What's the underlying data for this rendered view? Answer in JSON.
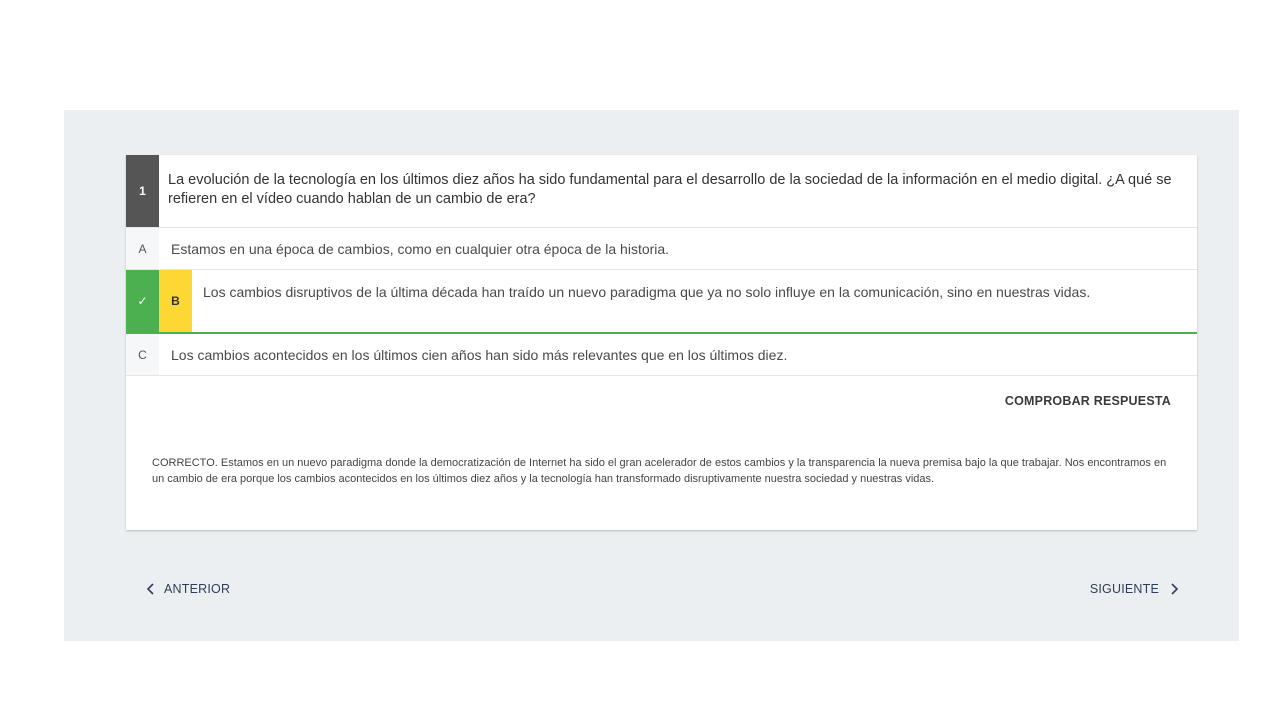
{
  "question": {
    "number": "1",
    "text": "La evolución de la tecnología en los últimos diez años ha sido fundamental para el desarrollo de la sociedad de la información en el medio digital. ¿A qué se refieren en el vídeo cuando hablan de un cambio de era?"
  },
  "options": [
    {
      "letter": "A",
      "text": "Estamos en una época de cambios, como en cualquier otra época de la historia."
    },
    {
      "letter": "B",
      "text": "Los cambios disruptivos de la última década han traído un nuevo paradigma que ya no solo influye en la comunicación, sino en nuestras vidas.",
      "selected": true,
      "correct": true
    },
    {
      "letter": "C",
      "text": "Los cambios acontecidos en los últimos cien años han sido más relevantes que en los últimos diez."
    }
  ],
  "check_mark": "✓",
  "check_button": "COMPROBAR RESPUESTA",
  "feedback": "CORRECTO. Estamos en un nuevo paradigma donde la democratización de Internet ha sido el gran acelerador de estos cambios y la transparencia la nueva premisa bajo la que trabajar. Nos encontramos en un cambio de era porque los cambios acontecidos en los últimos diez años y la tecnología han transformado disruptivamente nuestra sociedad y nuestras vidas.",
  "navigation": {
    "prev_label": "ANTERIOR",
    "next_label": "SIGUIENTE"
  },
  "icons": {
    "prev": "chevron-left-icon",
    "next": "chevron-right-icon",
    "correct": "checkmark-icon"
  },
  "colors": {
    "correct": "#4caf50",
    "selected_letter": "#fdd835",
    "question_number_bg": "#555555",
    "panel_bg": "#eceff1"
  }
}
